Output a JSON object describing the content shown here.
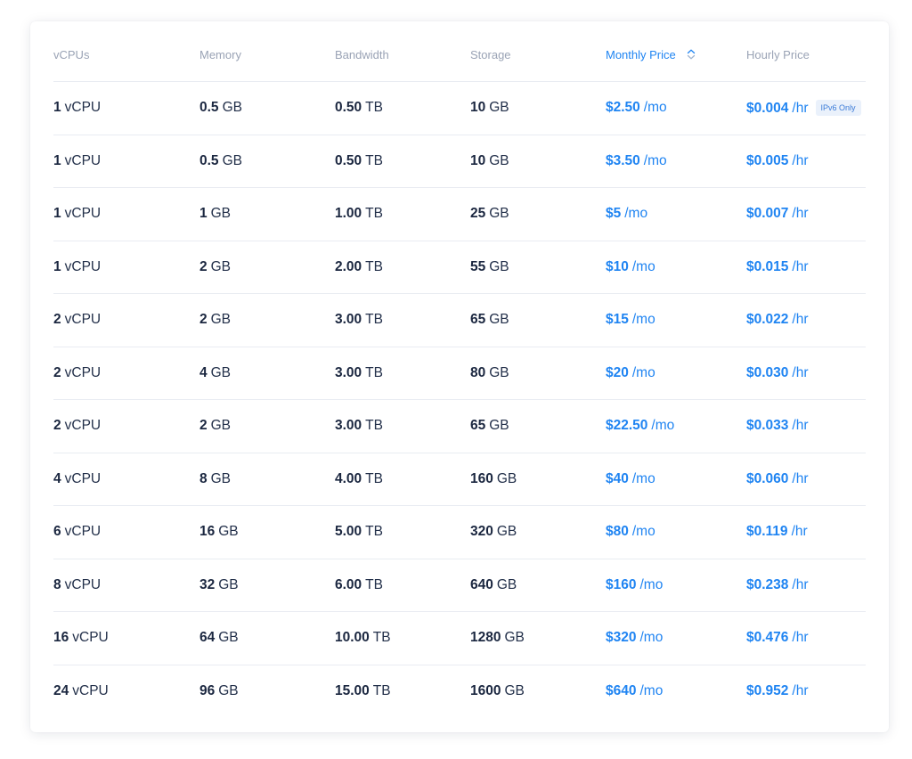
{
  "colors": {
    "accent": "#1f84f2",
    "heading": "#9aa3b5",
    "text": "#1b2740"
  },
  "headers": {
    "vcpus": "vCPUs",
    "memory": "Memory",
    "bandwidth": "Bandwidth",
    "storage": "Storage",
    "monthly_price": "Monthly Price",
    "hourly_price": "Hourly Price"
  },
  "sort_icon": "sort-arrows-icon",
  "rows": [
    {
      "vcpu": "1",
      "vcpu_unit": "vCPU",
      "memory": "0.5",
      "memory_unit": "GB",
      "bandwidth": "0.50",
      "bandwidth_unit": "TB",
      "storage": "10",
      "storage_unit": "GB",
      "monthly": "$2.50",
      "monthly_unit": "/mo",
      "hourly": "$0.004",
      "hourly_unit": "/hr",
      "badge": "IPv6 Only"
    },
    {
      "vcpu": "1",
      "vcpu_unit": "vCPU",
      "memory": "0.5",
      "memory_unit": "GB",
      "bandwidth": "0.50",
      "bandwidth_unit": "TB",
      "storage": "10",
      "storage_unit": "GB",
      "monthly": "$3.50",
      "monthly_unit": "/mo",
      "hourly": "$0.005",
      "hourly_unit": "/hr"
    },
    {
      "vcpu": "1",
      "vcpu_unit": "vCPU",
      "memory": "1",
      "memory_unit": "GB",
      "bandwidth": "1.00",
      "bandwidth_unit": "TB",
      "storage": "25",
      "storage_unit": "GB",
      "monthly": "$5",
      "monthly_unit": "/mo",
      "hourly": "$0.007",
      "hourly_unit": "/hr"
    },
    {
      "vcpu": "1",
      "vcpu_unit": "vCPU",
      "memory": "2",
      "memory_unit": "GB",
      "bandwidth": "2.00",
      "bandwidth_unit": "TB",
      "storage": "55",
      "storage_unit": "GB",
      "monthly": "$10",
      "monthly_unit": "/mo",
      "hourly": "$0.015",
      "hourly_unit": "/hr"
    },
    {
      "vcpu": "2",
      "vcpu_unit": "vCPU",
      "memory": "2",
      "memory_unit": "GB",
      "bandwidth": "3.00",
      "bandwidth_unit": "TB",
      "storage": "65",
      "storage_unit": "GB",
      "monthly": "$15",
      "monthly_unit": "/mo",
      "hourly": "$0.022",
      "hourly_unit": "/hr"
    },
    {
      "vcpu": "2",
      "vcpu_unit": "vCPU",
      "memory": "4",
      "memory_unit": "GB",
      "bandwidth": "3.00",
      "bandwidth_unit": "TB",
      "storage": "80",
      "storage_unit": "GB",
      "monthly": "$20",
      "monthly_unit": "/mo",
      "hourly": "$0.030",
      "hourly_unit": "/hr"
    },
    {
      "vcpu": "2",
      "vcpu_unit": "vCPU",
      "memory": "2",
      "memory_unit": "GB",
      "bandwidth": "3.00",
      "bandwidth_unit": "TB",
      "storage": "65",
      "storage_unit": "GB",
      "monthly": "$22.50",
      "monthly_unit": "/mo",
      "hourly": "$0.033",
      "hourly_unit": "/hr"
    },
    {
      "vcpu": "4",
      "vcpu_unit": "vCPU",
      "memory": "8",
      "memory_unit": "GB",
      "bandwidth": "4.00",
      "bandwidth_unit": "TB",
      "storage": "160",
      "storage_unit": "GB",
      "monthly": "$40",
      "monthly_unit": "/mo",
      "hourly": "$0.060",
      "hourly_unit": "/hr"
    },
    {
      "vcpu": "6",
      "vcpu_unit": "vCPU",
      "memory": "16",
      "memory_unit": "GB",
      "bandwidth": "5.00",
      "bandwidth_unit": "TB",
      "storage": "320",
      "storage_unit": "GB",
      "monthly": "$80",
      "monthly_unit": "/mo",
      "hourly": "$0.119",
      "hourly_unit": "/hr"
    },
    {
      "vcpu": "8",
      "vcpu_unit": "vCPU",
      "memory": "32",
      "memory_unit": "GB",
      "bandwidth": "6.00",
      "bandwidth_unit": "TB",
      "storage": "640",
      "storage_unit": "GB",
      "monthly": "$160",
      "monthly_unit": "/mo",
      "hourly": "$0.238",
      "hourly_unit": "/hr"
    },
    {
      "vcpu": "16",
      "vcpu_unit": "vCPU",
      "memory": "64",
      "memory_unit": "GB",
      "bandwidth": "10.00",
      "bandwidth_unit": "TB",
      "storage": "1280",
      "storage_unit": "GB",
      "monthly": "$320",
      "monthly_unit": "/mo",
      "hourly": "$0.476",
      "hourly_unit": "/hr"
    },
    {
      "vcpu": "24",
      "vcpu_unit": "vCPU",
      "memory": "96",
      "memory_unit": "GB",
      "bandwidth": "15.00",
      "bandwidth_unit": "TB",
      "storage": "1600",
      "storage_unit": "GB",
      "monthly": "$640",
      "monthly_unit": "/mo",
      "hourly": "$0.952",
      "hourly_unit": "/hr"
    }
  ]
}
